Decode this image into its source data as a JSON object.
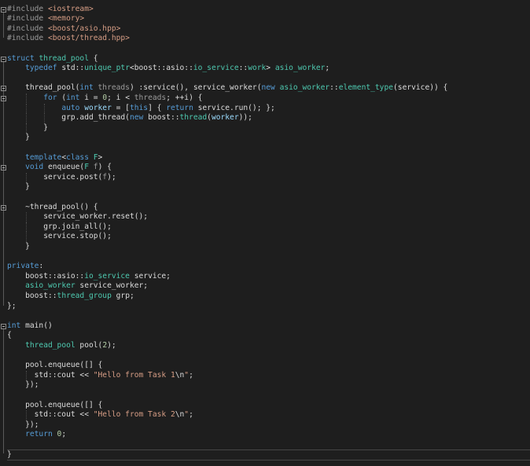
{
  "editor": {
    "language": "C++",
    "lines": [
      [
        {
          "t": "#include ",
          "c": "p"
        },
        {
          "t": "<iostream>",
          "c": "s"
        }
      ],
      [
        {
          "t": "#include ",
          "c": "p"
        },
        {
          "t": "<memory>",
          "c": "s"
        }
      ],
      [
        {
          "t": "#include ",
          "c": "p"
        },
        {
          "t": "<boost/asio.hpp>",
          "c": "s"
        }
      ],
      [
        {
          "t": "#include ",
          "c": "p"
        },
        {
          "t": "<boost/thread.hpp>",
          "c": "s"
        }
      ],
      [],
      [
        {
          "t": "struct ",
          "c": "k"
        },
        {
          "t": "thread_pool",
          "c": "t"
        },
        {
          "t": " {",
          "c": "d"
        }
      ],
      [
        {
          "t": "    ",
          "c": "d"
        },
        {
          "t": "typedef ",
          "c": "k"
        },
        {
          "t": "std::",
          "c": "d"
        },
        {
          "t": "unique_ptr",
          "c": "t"
        },
        {
          "t": "<boost::asio::",
          "c": "d"
        },
        {
          "t": "io_service",
          "c": "t"
        },
        {
          "t": "::",
          "c": "d"
        },
        {
          "t": "work",
          "c": "t"
        },
        {
          "t": "> ",
          "c": "d"
        },
        {
          "t": "asio_worker",
          "c": "t"
        },
        {
          "t": ";",
          "c": "d"
        }
      ],
      [],
      [
        {
          "t": "    thread_pool(",
          "c": "d"
        },
        {
          "t": "int ",
          "c": "k"
        },
        {
          "t": "threads",
          "c": "p"
        },
        {
          "t": ") :service(), service_worker(",
          "c": "d"
        },
        {
          "t": "new ",
          "c": "k"
        },
        {
          "t": "asio_worker",
          "c": "t"
        },
        {
          "t": "::",
          "c": "d"
        },
        {
          "t": "element_type",
          "c": "t"
        },
        {
          "t": "(service)) {",
          "c": "d"
        }
      ],
      [
        {
          "t": "        ",
          "c": "d"
        },
        {
          "t": "for ",
          "c": "k"
        },
        {
          "t": "(",
          "c": "d"
        },
        {
          "t": "int ",
          "c": "k"
        },
        {
          "t": "i = ",
          "c": "d"
        },
        {
          "t": "0",
          "c": "n"
        },
        {
          "t": "; i < ",
          "c": "d"
        },
        {
          "t": "threads",
          "c": "p"
        },
        {
          "t": "; ++i) {",
          "c": "d"
        }
      ],
      [
        {
          "t": "            ",
          "c": "d"
        },
        {
          "t": "auto ",
          "c": "k"
        },
        {
          "t": "worker",
          "c": "v"
        },
        {
          "t": " = [",
          "c": "d"
        },
        {
          "t": "this",
          "c": "k"
        },
        {
          "t": "] { ",
          "c": "d"
        },
        {
          "t": "return ",
          "c": "k"
        },
        {
          "t": "service.run(); };",
          "c": "d"
        }
      ],
      [
        {
          "t": "            grp.add_thread(",
          "c": "d"
        },
        {
          "t": "new ",
          "c": "k"
        },
        {
          "t": "boost::",
          "c": "d"
        },
        {
          "t": "thread",
          "c": "t"
        },
        {
          "t": "(",
          "c": "d"
        },
        {
          "t": "worker",
          "c": "v"
        },
        {
          "t": "));",
          "c": "d"
        }
      ],
      [
        {
          "t": "        }",
          "c": "d"
        }
      ],
      [
        {
          "t": "    }",
          "c": "d"
        }
      ],
      [],
      [
        {
          "t": "    ",
          "c": "d"
        },
        {
          "t": "template",
          "c": "k"
        },
        {
          "t": "<",
          "c": "d"
        },
        {
          "t": "class ",
          "c": "k"
        },
        {
          "t": "F",
          "c": "t"
        },
        {
          "t": ">",
          "c": "d"
        }
      ],
      [
        {
          "t": "    ",
          "c": "d"
        },
        {
          "t": "void ",
          "c": "k"
        },
        {
          "t": "enqueue(",
          "c": "d"
        },
        {
          "t": "F ",
          "c": "t"
        },
        {
          "t": "f",
          "c": "p"
        },
        {
          "t": ") {",
          "c": "d"
        }
      ],
      [
        {
          "t": "        service.post(",
          "c": "d"
        },
        {
          "t": "f",
          "c": "p"
        },
        {
          "t": ");",
          "c": "d"
        }
      ],
      [
        {
          "t": "    }",
          "c": "d"
        }
      ],
      [],
      [
        {
          "t": "    ~thread_pool() {",
          "c": "d"
        }
      ],
      [
        {
          "t": "        service_worker.reset();",
          "c": "d"
        }
      ],
      [
        {
          "t": "        grp.join_all();",
          "c": "d"
        }
      ],
      [
        {
          "t": "        service.stop();",
          "c": "d"
        }
      ],
      [
        {
          "t": "    }",
          "c": "d"
        }
      ],
      [],
      [
        {
          "t": "private",
          "c": "k"
        },
        {
          "t": ":",
          "c": "d"
        }
      ],
      [
        {
          "t": "    boost::asio::",
          "c": "d"
        },
        {
          "t": "io_service ",
          "c": "t"
        },
        {
          "t": "service;",
          "c": "d"
        }
      ],
      [
        {
          "t": "    ",
          "c": "d"
        },
        {
          "t": "asio_worker ",
          "c": "t"
        },
        {
          "t": "service_worker;",
          "c": "d"
        }
      ],
      [
        {
          "t": "    boost::",
          "c": "d"
        },
        {
          "t": "thread_group ",
          "c": "t"
        },
        {
          "t": "grp;",
          "c": "d"
        }
      ],
      [
        {
          "t": "};",
          "c": "d"
        }
      ],
      [],
      [
        {
          "t": "int ",
          "c": "k"
        },
        {
          "t": "main()",
          "c": "d"
        }
      ],
      [
        {
          "t": "{",
          "c": "d"
        }
      ],
      [
        {
          "t": "    ",
          "c": "d"
        },
        {
          "t": "thread_pool ",
          "c": "t"
        },
        {
          "t": "pool",
          "c": "d"
        },
        {
          "t": "(",
          "c": "d"
        },
        {
          "t": "2",
          "c": "n"
        },
        {
          "t": ");",
          "c": "d"
        }
      ],
      [],
      [
        {
          "t": "    pool.enqueue([] {",
          "c": "d"
        }
      ],
      [
        {
          "t": "      std::cout << ",
          "c": "d"
        },
        {
          "t": "\"Hello from Task 1",
          "c": "s"
        },
        {
          "t": "\\n",
          "c": "d"
        },
        {
          "t": "\"",
          "c": "s"
        },
        {
          "t": ";",
          "c": "d"
        }
      ],
      [
        {
          "t": "    });",
          "c": "d"
        }
      ],
      [],
      [
        {
          "t": "    pool.enqueue([] {",
          "c": "d"
        }
      ],
      [
        {
          "t": "      std::cout << ",
          "c": "d"
        },
        {
          "t": "\"Hello from Task 2",
          "c": "s"
        },
        {
          "t": "\\n",
          "c": "d"
        },
        {
          "t": "\"",
          "c": "s"
        },
        {
          "t": ";",
          "c": "d"
        }
      ],
      [
        {
          "t": "    });",
          "c": "d"
        }
      ],
      [
        {
          "t": "    ",
          "c": "d"
        },
        {
          "t": "return ",
          "c": "k"
        },
        {
          "t": "0",
          "c": "n"
        },
        {
          "t": ";",
          "c": "d"
        }
      ],
      [],
      [
        {
          "t": "}",
          "c": "d"
        }
      ]
    ],
    "folds": [
      0,
      5,
      8,
      9,
      16,
      20,
      32
    ],
    "cursor_line": 45
  }
}
